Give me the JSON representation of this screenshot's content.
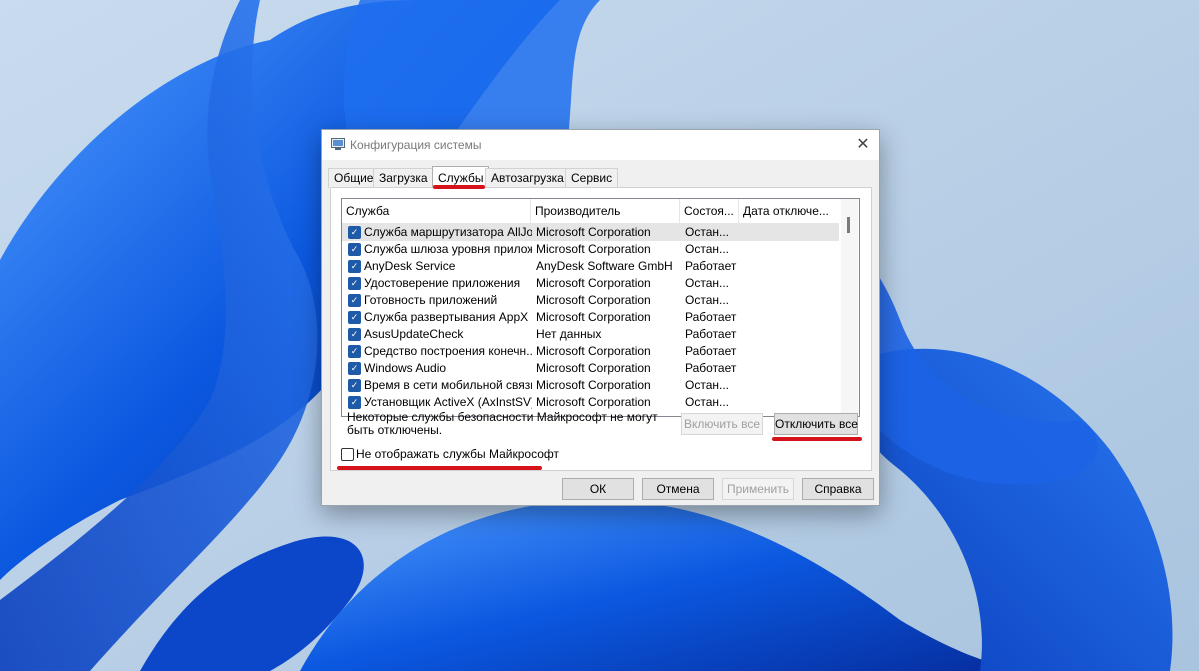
{
  "dialog": {
    "title": "Конфигурация системы",
    "close_glyph": "✕",
    "tabs": [
      {
        "label": "Общие",
        "active": false
      },
      {
        "label": "Загрузка",
        "active": false
      },
      {
        "label": "Службы",
        "active": true
      },
      {
        "label": "Автозагрузка",
        "active": false
      },
      {
        "label": "Сервис",
        "active": false
      }
    ],
    "columns": [
      "Служба",
      "Производитель",
      "Состоя...",
      "Дата отключе..."
    ],
    "services": [
      {
        "name": "Служба маршрутизатора AllJoyn",
        "vendor": "Microsoft Corporation",
        "status": "Остан...",
        "date": "",
        "checked": true
      },
      {
        "name": "Служба шлюза уровня прилож...",
        "vendor": "Microsoft Corporation",
        "status": "Остан...",
        "date": "",
        "checked": true
      },
      {
        "name": "AnyDesk Service",
        "vendor": "AnyDesk Software GmbH",
        "status": "Работает",
        "date": "",
        "checked": true
      },
      {
        "name": "Удостоверение приложения",
        "vendor": "Microsoft Corporation",
        "status": "Остан...",
        "date": "",
        "checked": true
      },
      {
        "name": "Готовность приложений",
        "vendor": "Microsoft Corporation",
        "status": "Остан...",
        "date": "",
        "checked": true
      },
      {
        "name": "Служба развертывания AppX (...",
        "vendor": "Microsoft Corporation",
        "status": "Работает",
        "date": "",
        "checked": true
      },
      {
        "name": "AsusUpdateCheck",
        "vendor": "Нет данных",
        "status": "Работает",
        "date": "",
        "checked": true
      },
      {
        "name": "Средство построения конечн...",
        "vendor": "Microsoft Corporation",
        "status": "Работает",
        "date": "",
        "checked": true
      },
      {
        "name": "Windows Audio",
        "vendor": "Microsoft Corporation",
        "status": "Работает",
        "date": "",
        "checked": true
      },
      {
        "name": "Время в сети мобильной связи",
        "vendor": "Microsoft Corporation",
        "status": "Остан...",
        "date": "",
        "checked": true
      },
      {
        "name": "Установщик ActiveX (AxInstSV)",
        "vendor": "Microsoft Corporation",
        "status": "Остан...",
        "date": "",
        "checked": true
      }
    ],
    "note": "Некоторые службы безопасности Майкрософт не могут быть отключены.",
    "enable_all": "Включить все",
    "disable_all": "Отключить все",
    "hide_ms_label": "Не отображать службы Майкрософт",
    "hide_ms_checked": false,
    "ok": "ОК",
    "cancel": "Отмена",
    "apply": "Применить",
    "help": "Справка"
  },
  "colors": {
    "highlight": "#d6121a",
    "checkbox": "#1e5aa8",
    "wallpaper_blue": "#0a50d8"
  }
}
